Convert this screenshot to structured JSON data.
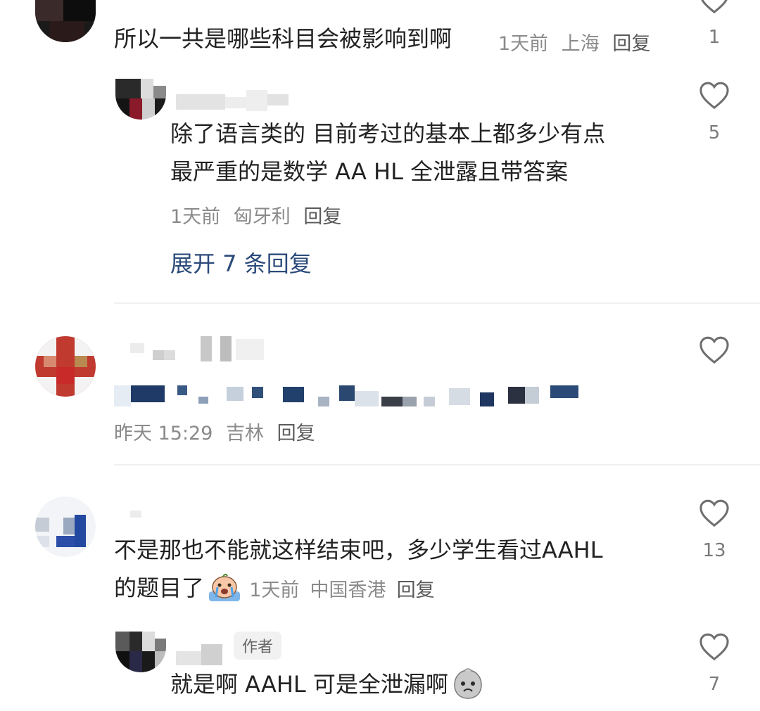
{
  "comments": [
    {
      "text": "所以一共是哪些科目会被影响到啊",
      "time": "1天前",
      "location": "上海",
      "reply": "回复",
      "likes": "1"
    },
    {
      "text_line1": "除了语言类的 目前考过的基本上都多少有点",
      "text_line2": "最严重的是数学 AA HL 全泄露且带答案",
      "time": "1天前",
      "location": "匈牙利",
      "reply": "回复",
      "likes": "5",
      "expand": "展开 7 条回复"
    },
    {
      "time": "昨天 15:29",
      "location": "吉林",
      "reply": "回复",
      "likes": ""
    },
    {
      "text_line1": "不是那也不能就这样结束吧，多少学生看过AAHL",
      "text_line2": "的题目了",
      "time": "1天前",
      "location": "中国香港",
      "reply": "回复",
      "likes": "13"
    },
    {
      "badge": "作者",
      "text": "就是啊 AAHL 可是全泄漏啊",
      "likes": "7"
    }
  ],
  "icons": {
    "heart": "heart-outline-icon",
    "emoji_cry": "crying-emoji-icon",
    "emoji_sad": "sad-face-emoji-icon"
  },
  "colors": {
    "link": "#2b4a7a",
    "meta": "#8a8a8a",
    "heart": "#7a7a7a"
  }
}
